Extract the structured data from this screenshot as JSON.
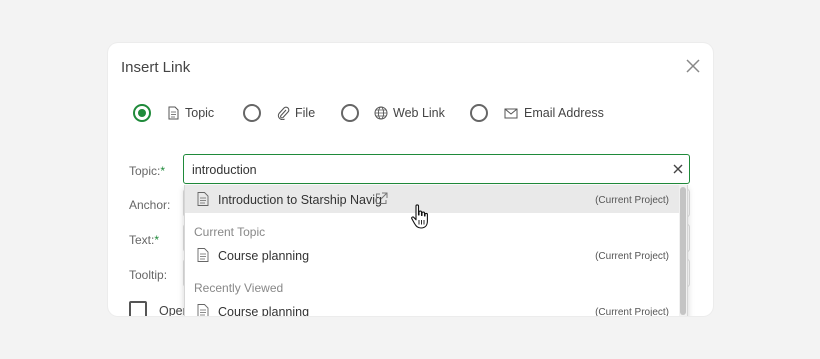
{
  "dialog": {
    "title": "Insert Link",
    "link_types": [
      {
        "label": "Topic",
        "icon": "document-icon",
        "selected": true
      },
      {
        "label": "File",
        "icon": "paperclip-icon",
        "selected": false
      },
      {
        "label": "Web Link",
        "icon": "globe-icon",
        "selected": false
      },
      {
        "label": "Email Address",
        "icon": "envelope-icon",
        "selected": false
      }
    ],
    "fields": {
      "topic_label": "Topic:",
      "topic_value": "introduction",
      "anchor_label": "Anchor:",
      "text_label": "Text:",
      "tooltip_label": "Tooltip:",
      "required_mark": "*"
    },
    "open_new_window_label": "Open"
  },
  "dropdown": {
    "results": [
      {
        "name": "Introduction to Starship Navig",
        "project": "(Current Project)",
        "highlighted": true
      }
    ],
    "groups": [
      {
        "label": "Current Topic",
        "items": [
          {
            "name": "Course planning",
            "project": "(Current Project)"
          }
        ]
      },
      {
        "label": "Recently Viewed",
        "items": [
          {
            "name": "Course planning",
            "project": "(Current Project)"
          }
        ]
      }
    ]
  },
  "colors": {
    "accent": "#1f8a3a",
    "highlight": "#e9e9e9"
  }
}
